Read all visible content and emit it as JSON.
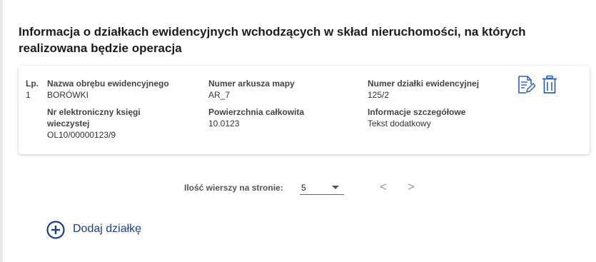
{
  "section": {
    "title": "Informacja o działkach ewidencyjnych wchodzących w skład nieruchomości, na których realizowana będzie operacja"
  },
  "record": {
    "lp_label": "Lp.",
    "lp_value": "1",
    "obreb_label": "Nazwa obrębu ewidencyjnego",
    "obreb_value": "BORÓWKI",
    "arkusz_label": "Numer arkusza mapy",
    "arkusz_value": "AR_7",
    "dzialka_label": "Numer działki ewidencyjnej",
    "dzialka_value": "125/2",
    "ksiega_label_1": "Nr elektroniczny księgi",
    "ksiega_label_2": "wieczystej",
    "ksiega_value": "OL10/00000123/9",
    "powierzchnia_label": "Powierzchnia całkowita",
    "powierzchnia_value": "10.0123",
    "info_label": "Informacje szczegółowe",
    "info_value": "Tekst dodatkowy",
    "edit_icon": "edit-document-icon",
    "delete_icon": "trash-icon",
    "accent": "#2f63b8"
  },
  "pagination": {
    "rows_label": "Ilość wierszy na stronie:",
    "rows_value": "5",
    "prev": "<",
    "next": ">"
  },
  "add": {
    "label": "Dodaj działkę",
    "icon": "plus-circle-icon"
  }
}
